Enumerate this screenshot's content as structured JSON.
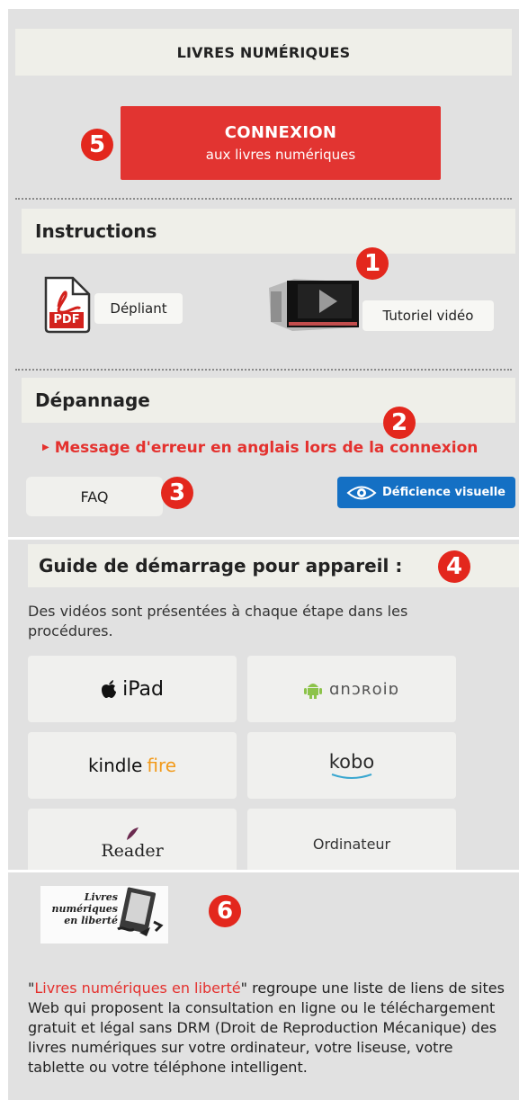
{
  "header": {
    "title": "LIVRES NUMÉRIQUES"
  },
  "connect": {
    "line1": "CONNEXION",
    "line2": "aux livres numériques"
  },
  "instructions": {
    "title": "Instructions",
    "pdf_label": "Dépliant",
    "pdf_icon_text": "PDF",
    "video_label": "Tutoriel vidéo"
  },
  "troubleshooting": {
    "title": "Dépannage",
    "error_link": "Message d'erreur en anglais lors de la connexion",
    "faq": "FAQ",
    "vision": "Déficience visuelle"
  },
  "guide": {
    "title": "Guide de démarrage pour appareil :",
    "text": "Des vidéos sont présentées à chaque étape dans les procédures.",
    "devices": {
      "ipad": "iPad",
      "android": "ɑnɔʀoiɒ",
      "kindle": "kindle",
      "fire": "fire",
      "kobo": "kobo",
      "reader": "Reader",
      "computer": "Ordinateur"
    }
  },
  "liberty": {
    "image_line1": "Livres",
    "image_line2": "numériques",
    "image_line3": "en liberté",
    "quote_open": "\"",
    "link": "Livres numériques en liberté",
    "quote_close": "\"",
    "text": " regroupe une liste de liens de sites Web qui proposent la consultation en ligne ou le téléchargement gratuit et légal sans DRM (Droit de Reproduction Mécanique) des livres numériques sur votre ordinateur, votre liseuse, votre tablette ou votre téléphone intelligent."
  },
  "badges": {
    "b1": "1",
    "b2": "2",
    "b3": "3",
    "b4": "4",
    "b5": "5",
    "b6": "6"
  },
  "colors": {
    "accent_red": "#e23431",
    "badge_red": "#e3271d",
    "blue": "#1470c4",
    "panel_bg": "#e1e1e1"
  }
}
